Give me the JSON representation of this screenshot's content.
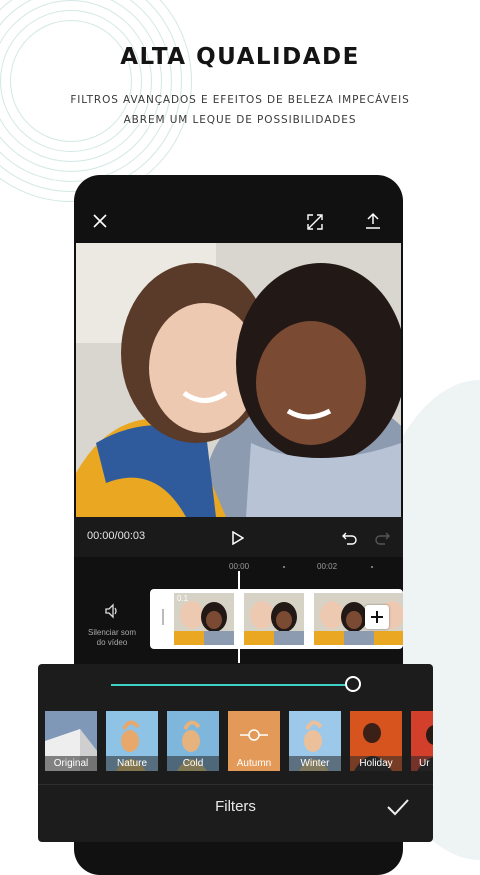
{
  "promo": {
    "heading": "ALTA QUALIDADE",
    "subline_1": "FILTROS AVANÇADOS E EFEITOS DE BELEZA IMPECÁVEIS",
    "subline_2": "ABREM UM LEQUE DE POSSIBILIDADES"
  },
  "editor": {
    "timecode": "00:00/00:03",
    "ruler_ticks": [
      "00:00",
      "00:02"
    ],
    "mute_label_1": "Silenciar som",
    "mute_label_2": "do vídeo",
    "clip_overlay": "0.1"
  },
  "filters_panel": {
    "title": "Filters",
    "intensity": 0.95,
    "accent": "#3fd0c6",
    "selected_color": "#e39a58",
    "items": [
      {
        "label": "Original"
      },
      {
        "label": "Nature"
      },
      {
        "label": "Cold"
      },
      {
        "label": "Autumn"
      },
      {
        "label": "Winter"
      },
      {
        "label": "Holiday"
      },
      {
        "label": "Ur"
      }
    ],
    "selected_index": 3
  },
  "icons": {
    "close": "close-icon",
    "fullscreen": "fullscreen-icon",
    "export": "export-icon",
    "play": "play-icon",
    "undo": "undo-icon",
    "redo": "redo-icon",
    "speaker": "speaker-icon",
    "add": "add-icon",
    "confirm": "check-icon",
    "filter": "filter-slider-icon"
  }
}
